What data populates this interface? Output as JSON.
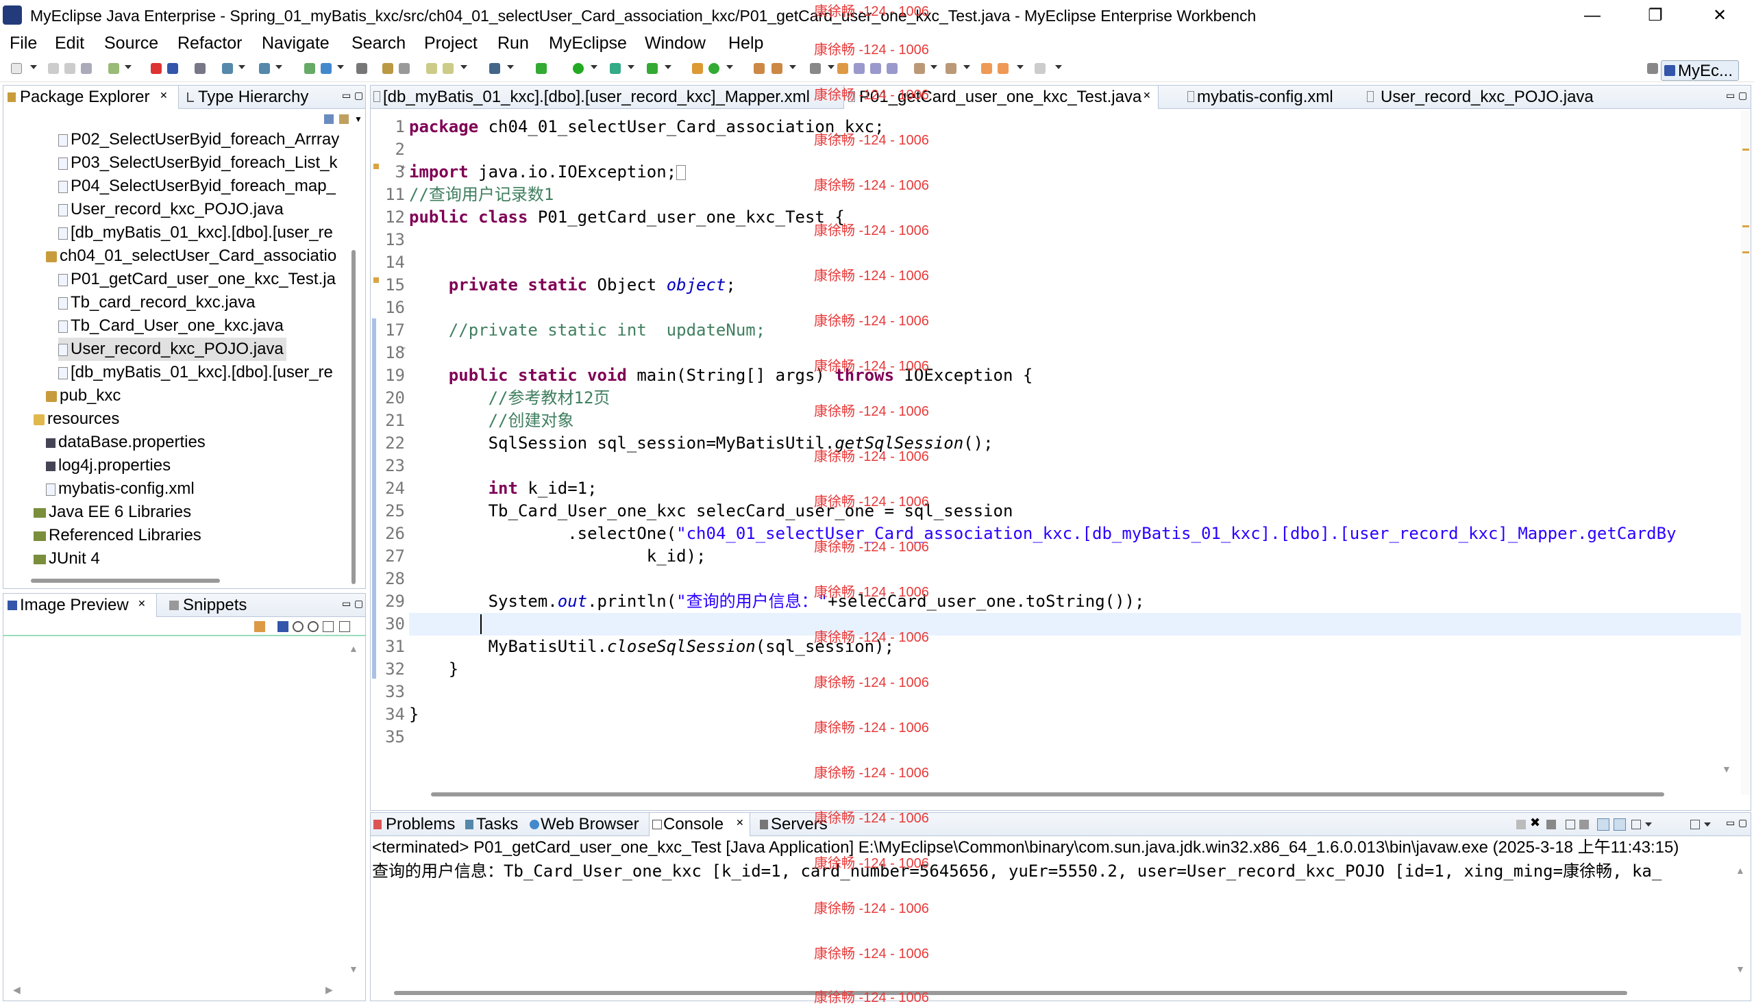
{
  "window": {
    "title": "MyEclipse Java Enterprise - Spring_01_myBatis_kxc/src/ch04_01_selectUser_Card_association_kxc/P01_getCard_user_one_kxc_Test.java - MyEclipse Enterprise Workbench",
    "minimize": "—",
    "maximize": "❐",
    "close": "✕"
  },
  "menu": [
    "File",
    "Edit",
    "Source",
    "Refactor",
    "Navigate",
    "Search",
    "Project",
    "Run",
    "MyEclipse",
    "Window",
    "Help"
  ],
  "perspective": "MyEc...",
  "explorer": {
    "tabs": [
      "Package Explorer",
      "Type Hierarchy"
    ],
    "items": [
      {
        "label": "P02_SelectUserByid_foreach_Arrray",
        "icon": "java"
      },
      {
        "label": "P03_SelectUserByid_foreach_List_k",
        "icon": "java"
      },
      {
        "label": "P04_SelectUserByid_foreach_map_",
        "icon": "java"
      },
      {
        "label": "User_record_kxc_POJO.java",
        "icon": "java"
      },
      {
        "label": "[db_myBatis_01_kxc].[dbo].[user_re",
        "icon": "xml"
      },
      {
        "label": "ch04_01_selectUser_Card_associatio",
        "icon": "pkg"
      },
      {
        "label": "P01_getCard_user_one_kxc_Test.ja",
        "icon": "java"
      },
      {
        "label": "Tb_card_record_kxc.java",
        "icon": "java"
      },
      {
        "label": "Tb_Card_User_one_kxc.java",
        "icon": "java"
      },
      {
        "label": "User_record_kxc_POJO.java",
        "icon": "java"
      },
      {
        "label": "[db_myBatis_01_kxc].[dbo].[user_re",
        "icon": "xml"
      },
      {
        "label": "pub_kxc",
        "icon": "pkg"
      },
      {
        "label": "resources",
        "icon": "folder"
      },
      {
        "label": "dataBase.properties",
        "icon": "props"
      },
      {
        "label": "log4j.properties",
        "icon": "props"
      },
      {
        "label": "mybatis-config.xml",
        "icon": "xml"
      },
      {
        "label": "Java EE 6 Libraries",
        "icon": "lib"
      },
      {
        "label": "Referenced Libraries",
        "icon": "lib"
      },
      {
        "label": "JUnit 4",
        "icon": "lib"
      }
    ]
  },
  "preview": {
    "tabs": [
      "Image Preview",
      "Snippets"
    ]
  },
  "editor": {
    "tabs": [
      "[db_myBatis_01_kxc].[dbo].[user_record_kxc]_Mapper.xml",
      "P01_getCard_user_one_kxc_Test.java",
      "mybatis-config.xml",
      "User_record_kxc_POJO.java"
    ],
    "line_numbers": [
      "1",
      "2",
      "3",
      "11",
      "12",
      "13",
      "14",
      "15",
      "16",
      "17",
      "18",
      "19",
      "20",
      "21",
      "22",
      "23",
      "24",
      "25",
      "26",
      "27",
      "28",
      "29",
      "30",
      "31",
      "32",
      "33",
      "34",
      "35"
    ],
    "code": {
      "l1a": "package",
      "l1b": " ch04_01_selectUser_Card_association_kxc;",
      "l3a": "import",
      "l3b": " java.io.IOException;",
      "l11": "//查询用户记录数1",
      "l12a": "public class",
      "l12b": " P01_getCard_user_one_kxc_Test {",
      "l15a": "    private static",
      "l15b": " Object ",
      "l15c": "object",
      "l15d": ";",
      "l17": "    //private static int  updateNum;",
      "l19a": "    public static void",
      "l19b": " main(String[] args) ",
      "l19c": "throws",
      "l19d": " IOException {",
      "l20": "        //参考教材12页",
      "l21": "        //创建对象",
      "l22a": "        SqlSession sql_session=MyBatisUtil.",
      "l22b": "getSqlSession",
      "l22c": "();",
      "l24a": "        int",
      "l24b": " k_id=1;",
      "l25": "        Tb_Card_User_one_kxc selecCard_user_one = sql_session",
      "l26a": "                .selectOne(",
      "l26b": "\"ch04_01_selectUser_Card_association_kxc.[db_myBatis_01_kxc].[dbo].[user_record_kxc]_Mapper.getCardBy",
      "l27": "                        k_id);",
      "l29a": "        System.",
      "l29b": "out",
      "l29c": ".println(",
      "l29d": "\"查询的用户信息：\"",
      "l29e": "+selecCard_user_one.toString());",
      "l31a": "        MyBatisUtil.",
      "l31b": "closeSqlSession",
      "l31c": "(sql_session);",
      "l32": "    }",
      "l34": "}"
    }
  },
  "bottom": {
    "tabs": [
      "Problems",
      "Tasks",
      "Web Browser",
      "Console",
      "Servers"
    ],
    "terminated": "<terminated> P01_getCard_user_one_kxc_Test [Java Application] E:\\MyEclipse\\Common\\binary\\com.sun.java.jdk.win32.x86_64_1.6.0.013\\bin\\javaw.exe (2025-3-18 上午11:43:15)",
    "output": "查询的用户信息：Tb_Card_User_one_kxc [k_id=1, card_number=5645656, yuEr=5550.2, user=User_record_kxc_POJO [id=1, xing_ming=康徐畅, ka_"
  },
  "watermark": "康徐畅 -124 - 1006"
}
